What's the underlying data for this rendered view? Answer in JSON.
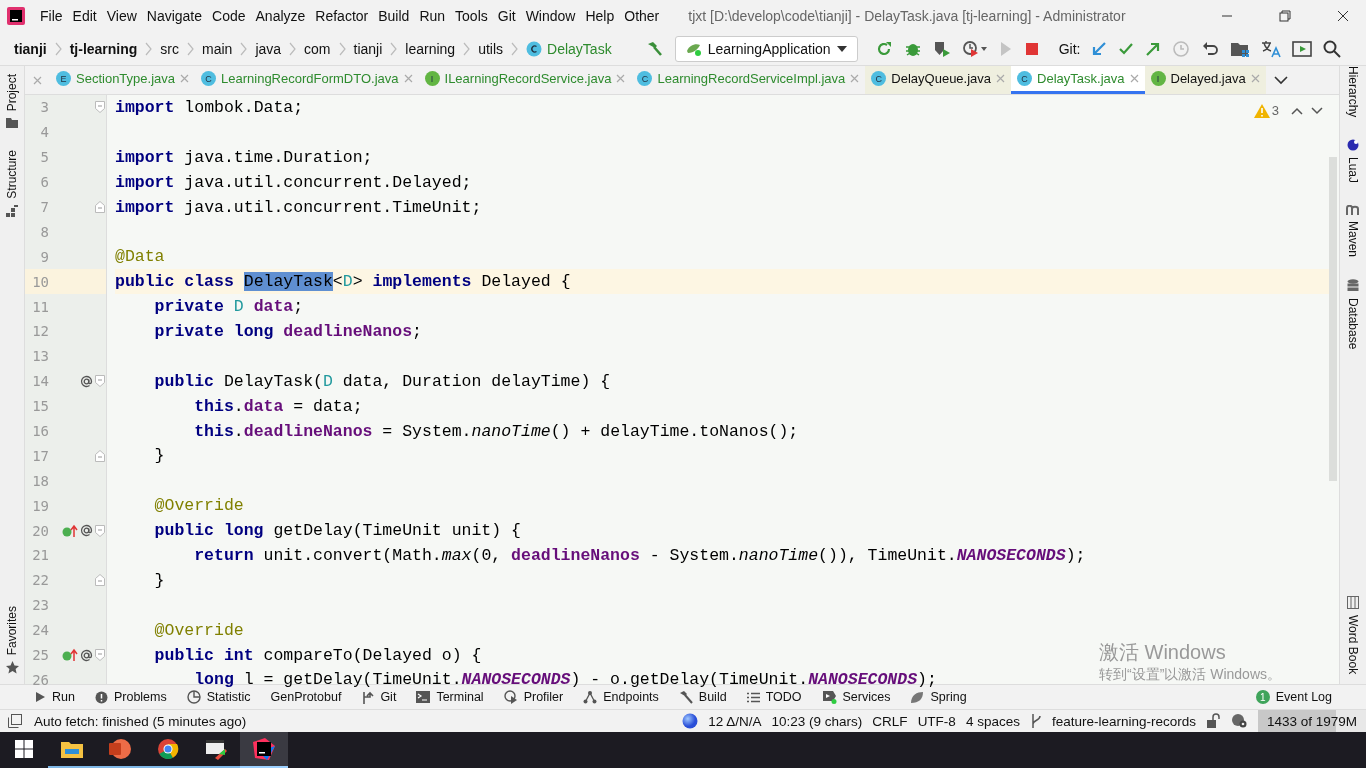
{
  "window": {
    "title": "tjxt [D:\\develop\\code\\tianji] - DelayTask.java [tj-learning] - Administrator"
  },
  "menu": [
    "File",
    "Edit",
    "View",
    "Navigate",
    "Code",
    "Analyze",
    "Refactor",
    "Build",
    "Run",
    "Tools",
    "Git",
    "Window",
    "Help",
    "Other"
  ],
  "breadcrumbs": [
    {
      "label": "tianji",
      "kind": "project"
    },
    {
      "label": "tj-learning",
      "kind": "module"
    },
    {
      "label": "src",
      "kind": "dir"
    },
    {
      "label": "main",
      "kind": "dir"
    },
    {
      "label": "java",
      "kind": "dir"
    },
    {
      "label": "com",
      "kind": "dir"
    },
    {
      "label": "tianji",
      "kind": "dir"
    },
    {
      "label": "learning",
      "kind": "dir"
    },
    {
      "label": "utils",
      "kind": "dir"
    },
    {
      "label": "DelayTask",
      "kind": "class"
    }
  ],
  "toolbar": {
    "run_config": "LearningApplication",
    "git_label": "Git:"
  },
  "tabs": [
    {
      "label": "SectionType.java",
      "badge": "E",
      "kind": "enum",
      "library": false,
      "selected": false
    },
    {
      "label": "LearningRecordFormDTO.java",
      "badge": "C",
      "kind": "class",
      "library": false,
      "selected": false
    },
    {
      "label": "ILearningRecordService.java",
      "badge": "I",
      "kind": "interface",
      "library": false,
      "selected": false
    },
    {
      "label": "LearningRecordServiceImpl.java",
      "badge": "C",
      "kind": "class",
      "library": false,
      "selected": false
    },
    {
      "label": "DelayQueue.java",
      "badge": "C",
      "kind": "class",
      "library": true,
      "selected": false
    },
    {
      "label": "DelayTask.java",
      "badge": "C",
      "kind": "class",
      "library": false,
      "selected": true
    },
    {
      "label": "Delayed.java",
      "badge": "I",
      "kind": "interface",
      "library": true,
      "selected": false
    }
  ],
  "left_tools": [
    {
      "label": "Project",
      "kind": "folder"
    },
    {
      "label": "Structure",
      "kind": "structure"
    }
  ],
  "left_tools_bottom": [
    {
      "label": "Favorites",
      "kind": "star"
    }
  ],
  "right_tools": [
    {
      "label": "Hierarchy",
      "kind": "none"
    },
    {
      "label": "LuaJ",
      "kind": "luaj"
    },
    {
      "label": "Maven",
      "kind": "maven"
    },
    {
      "label": "Database",
      "kind": "database"
    }
  ],
  "right_tools_bottom": [
    {
      "label": "Word Book",
      "kind": "book"
    }
  ],
  "inspections": {
    "warnings": "3"
  },
  "code_lines": [
    {
      "n": "3",
      "current": false,
      "implements": false,
      "annotated": false,
      "fold_start": true,
      "fold_end": false,
      "tokens": [
        {
          "text": "import",
          "kind": "keyword"
        },
        {
          "text": " lombok.Data;",
          "kind": "plain"
        }
      ]
    },
    {
      "n": "4",
      "current": false,
      "implements": false,
      "annotated": false,
      "fold_start": false,
      "fold_end": false
    },
    {
      "n": "5",
      "current": false,
      "implements": false,
      "annotated": false,
      "fold_start": false,
      "fold_end": false,
      "tokens": [
        {
          "text": "import",
          "kind": "keyword"
        },
        {
          "text": " java.time.Duration;",
          "kind": "plain"
        }
      ]
    },
    {
      "n": "6",
      "current": false,
      "implements": false,
      "annotated": false,
      "fold_start": false,
      "fold_end": false,
      "tokens": [
        {
          "text": "import",
          "kind": "keyword"
        },
        {
          "text": " java.util.concurrent.Delayed;",
          "kind": "plain"
        }
      ]
    },
    {
      "n": "7",
      "current": false,
      "implements": false,
      "annotated": false,
      "fold_start": false,
      "fold_end": true,
      "tokens": [
        {
          "text": "import",
          "kind": "keyword"
        },
        {
          "text": " java.util.concurrent.TimeUnit;",
          "kind": "plain"
        }
      ]
    },
    {
      "n": "8",
      "current": false,
      "implements": false,
      "annotated": false,
      "fold_start": false,
      "fold_end": false
    },
    {
      "n": "9",
      "current": false,
      "implements": false,
      "annotated": false,
      "fold_start": false,
      "fold_end": false,
      "tokens": [
        {
          "text": "@Data",
          "kind": "annotation"
        }
      ]
    },
    {
      "n": "10",
      "current": true,
      "implements": false,
      "annotated": false,
      "fold_start": false,
      "fold_end": false,
      "tokens": [
        {
          "text": "public class ",
          "kind": "keyword"
        },
        {
          "text": "DelayTask",
          "kind": "selection"
        },
        {
          "text": "<",
          "kind": "plain"
        },
        {
          "text": "D",
          "kind": "typeparam"
        },
        {
          "text": "> ",
          "kind": "plain"
        },
        {
          "text": "implements",
          "kind": "keyword"
        },
        {
          "text": " Delayed {",
          "kind": "plain"
        }
      ]
    },
    {
      "n": "11",
      "current": false,
      "implements": false,
      "annotated": false,
      "fold_start": false,
      "fold_end": false,
      "tokens": [
        {
          "text": "    private ",
          "kind": "keyword"
        },
        {
          "text": "D",
          "kind": "typeparam"
        },
        {
          "text": " data",
          "kind": "field"
        },
        {
          "text": ";",
          "kind": "plain"
        }
      ]
    },
    {
      "n": "12",
      "current": false,
      "implements": false,
      "annotated": false,
      "fold_start": false,
      "fold_end": false,
      "tokens": [
        {
          "text": "    private long ",
          "kind": "keyword"
        },
        {
          "text": "deadlineNanos",
          "kind": "field"
        },
        {
          "text": ";",
          "kind": "plain"
        }
      ]
    },
    {
      "n": "13",
      "current": false,
      "implements": false,
      "annotated": false,
      "fold_start": false,
      "fold_end": false
    },
    {
      "n": "14",
      "current": false,
      "implements": false,
      "annotated": true,
      "fold_start": true,
      "fold_end": false,
      "tokens": [
        {
          "text": "    public ",
          "kind": "keyword"
        },
        {
          "text": "DelayTask(",
          "kind": "plain"
        },
        {
          "text": "D",
          "kind": "typeparam"
        },
        {
          "text": " data, Duration delayTime) {",
          "kind": "plain"
        }
      ]
    },
    {
      "n": "15",
      "current": false,
      "implements": false,
      "annotated": false,
      "fold_start": false,
      "fold_end": false,
      "tokens": [
        {
          "text": "        this",
          "kind": "keyword"
        },
        {
          "text": ".",
          "kind": "plain"
        },
        {
          "text": "data",
          "kind": "field"
        },
        {
          "text": " = data;",
          "kind": "plain"
        }
      ]
    },
    {
      "n": "16",
      "current": false,
      "implements": false,
      "annotated": false,
      "fold_start": false,
      "fold_end": false,
      "tokens": [
        {
          "text": "        this",
          "kind": "keyword"
        },
        {
          "text": ".",
          "kind": "plain"
        },
        {
          "text": "deadlineNanos",
          "kind": "field"
        },
        {
          "text": " = System.",
          "kind": "plain"
        },
        {
          "text": "nanoTime",
          "kind": "static_method"
        },
        {
          "text": "() + delayTime.toNanos();",
          "kind": "plain"
        }
      ]
    },
    {
      "n": "17",
      "current": false,
      "implements": false,
      "annotated": false,
      "fold_start": false,
      "fold_end": true,
      "tokens": [
        {
          "text": "    }",
          "kind": "plain"
        }
      ]
    },
    {
      "n": "18",
      "current": false,
      "implements": false,
      "annotated": false,
      "fold_start": false,
      "fold_end": false
    },
    {
      "n": "19",
      "current": false,
      "implements": false,
      "annotated": false,
      "fold_start": false,
      "fold_end": false,
      "tokens": [
        {
          "text": "    @Override",
          "kind": "annotation"
        }
      ]
    },
    {
      "n": "20",
      "current": false,
      "implements": true,
      "annotated": true,
      "fold_start": true,
      "fold_end": false,
      "tokens": [
        {
          "text": "    public long ",
          "kind": "keyword"
        },
        {
          "text": "getDelay(TimeUnit unit) {",
          "kind": "plain"
        }
      ]
    },
    {
      "n": "21",
      "current": false,
      "implements": false,
      "annotated": false,
      "fold_start": false,
      "fold_end": false,
      "tokens": [
        {
          "text": "        return ",
          "kind": "keyword"
        },
        {
          "text": "unit.convert(Math.",
          "kind": "plain"
        },
        {
          "text": "max",
          "kind": "static_method"
        },
        {
          "text": "(0, ",
          "kind": "plain"
        },
        {
          "text": "deadlineNanos",
          "kind": "field"
        },
        {
          "text": " - System.",
          "kind": "plain"
        },
        {
          "text": "nanoTime",
          "kind": "static_method"
        },
        {
          "text": "()), TimeUnit.",
          "kind": "plain"
        },
        {
          "text": "NANOSECONDS",
          "kind": "constant"
        },
        {
          "text": ");",
          "kind": "plain"
        }
      ]
    },
    {
      "n": "22",
      "current": false,
      "implements": false,
      "annotated": false,
      "fold_start": false,
      "fold_end": true,
      "tokens": [
        {
          "text": "    }",
          "kind": "plain"
        }
      ]
    },
    {
      "n": "23",
      "current": false,
      "implements": false,
      "annotated": false,
      "fold_start": false,
      "fold_end": false
    },
    {
      "n": "24",
      "current": false,
      "implements": false,
      "annotated": false,
      "fold_start": false,
      "fold_end": false,
      "tokens": [
        {
          "text": "    @Override",
          "kind": "annotation"
        }
      ]
    },
    {
      "n": "25",
      "current": false,
      "implements": true,
      "annotated": true,
      "fold_start": true,
      "fold_end": false,
      "tokens": [
        {
          "text": "    public int ",
          "kind": "keyword"
        },
        {
          "text": "compareTo(Delayed o) {",
          "kind": "plain"
        }
      ]
    },
    {
      "n": "26",
      "current": false,
      "implements": false,
      "annotated": false,
      "fold_start": false,
      "fold_end": false,
      "tokens": [
        {
          "text": "        long ",
          "kind": "keyword"
        },
        {
          "text": "l = getDelay(TimeUnit.",
          "kind": "plain"
        },
        {
          "text": "NANOSECONDS",
          "kind": "constant"
        },
        {
          "text": ") - o.getDelay(TimeUnit.",
          "kind": "plain"
        },
        {
          "text": "NANOSECONDS",
          "kind": "constant"
        },
        {
          "text": ");",
          "kind": "plain"
        }
      ]
    }
  ],
  "activation": {
    "title": "激活 Windows",
    "hint": "转到“设置”以激活 Windows。"
  },
  "bottom_tools": [
    {
      "label": "Run",
      "kind": "run"
    },
    {
      "label": "Problems",
      "kind": "problems"
    },
    {
      "label": "Statistic",
      "kind": "statistic"
    },
    {
      "label": "GenProtobuf",
      "kind": "none"
    },
    {
      "label": "Git",
      "kind": "git"
    },
    {
      "label": "Terminal",
      "kind": "terminal"
    },
    {
      "label": "Profiler",
      "kind": "profiler"
    },
    {
      "label": "Endpoints",
      "kind": "endpoints"
    },
    {
      "label": "Build",
      "kind": "build"
    },
    {
      "label": "TODO",
      "kind": "todo"
    },
    {
      "label": "Services",
      "kind": "services"
    },
    {
      "label": "Spring",
      "kind": "spring"
    }
  ],
  "event_log": {
    "badge": "1",
    "label": "Event Log"
  },
  "status_bar": {
    "message": "Auto fetch: finished (5 minutes ago)",
    "vcs": "12 Δ/N/A",
    "position": "10:23 (9 chars)",
    "line_separator": "CRLF",
    "encoding": "UTF-8",
    "indent": "4 spaces",
    "branch": "feature-learning-records",
    "memory": {
      "text": "1433 of 1979M",
      "level": 0.72
    }
  },
  "taskbar": [
    {
      "kind": "start",
      "selected": false
    },
    {
      "kind": "explorer",
      "selected": false
    },
    {
      "kind": "powerpoint",
      "selected": false
    },
    {
      "kind": "chrome",
      "selected": false
    },
    {
      "kind": "tool",
      "selected": false
    },
    {
      "kind": "intellij",
      "selected": true
    }
  ]
}
